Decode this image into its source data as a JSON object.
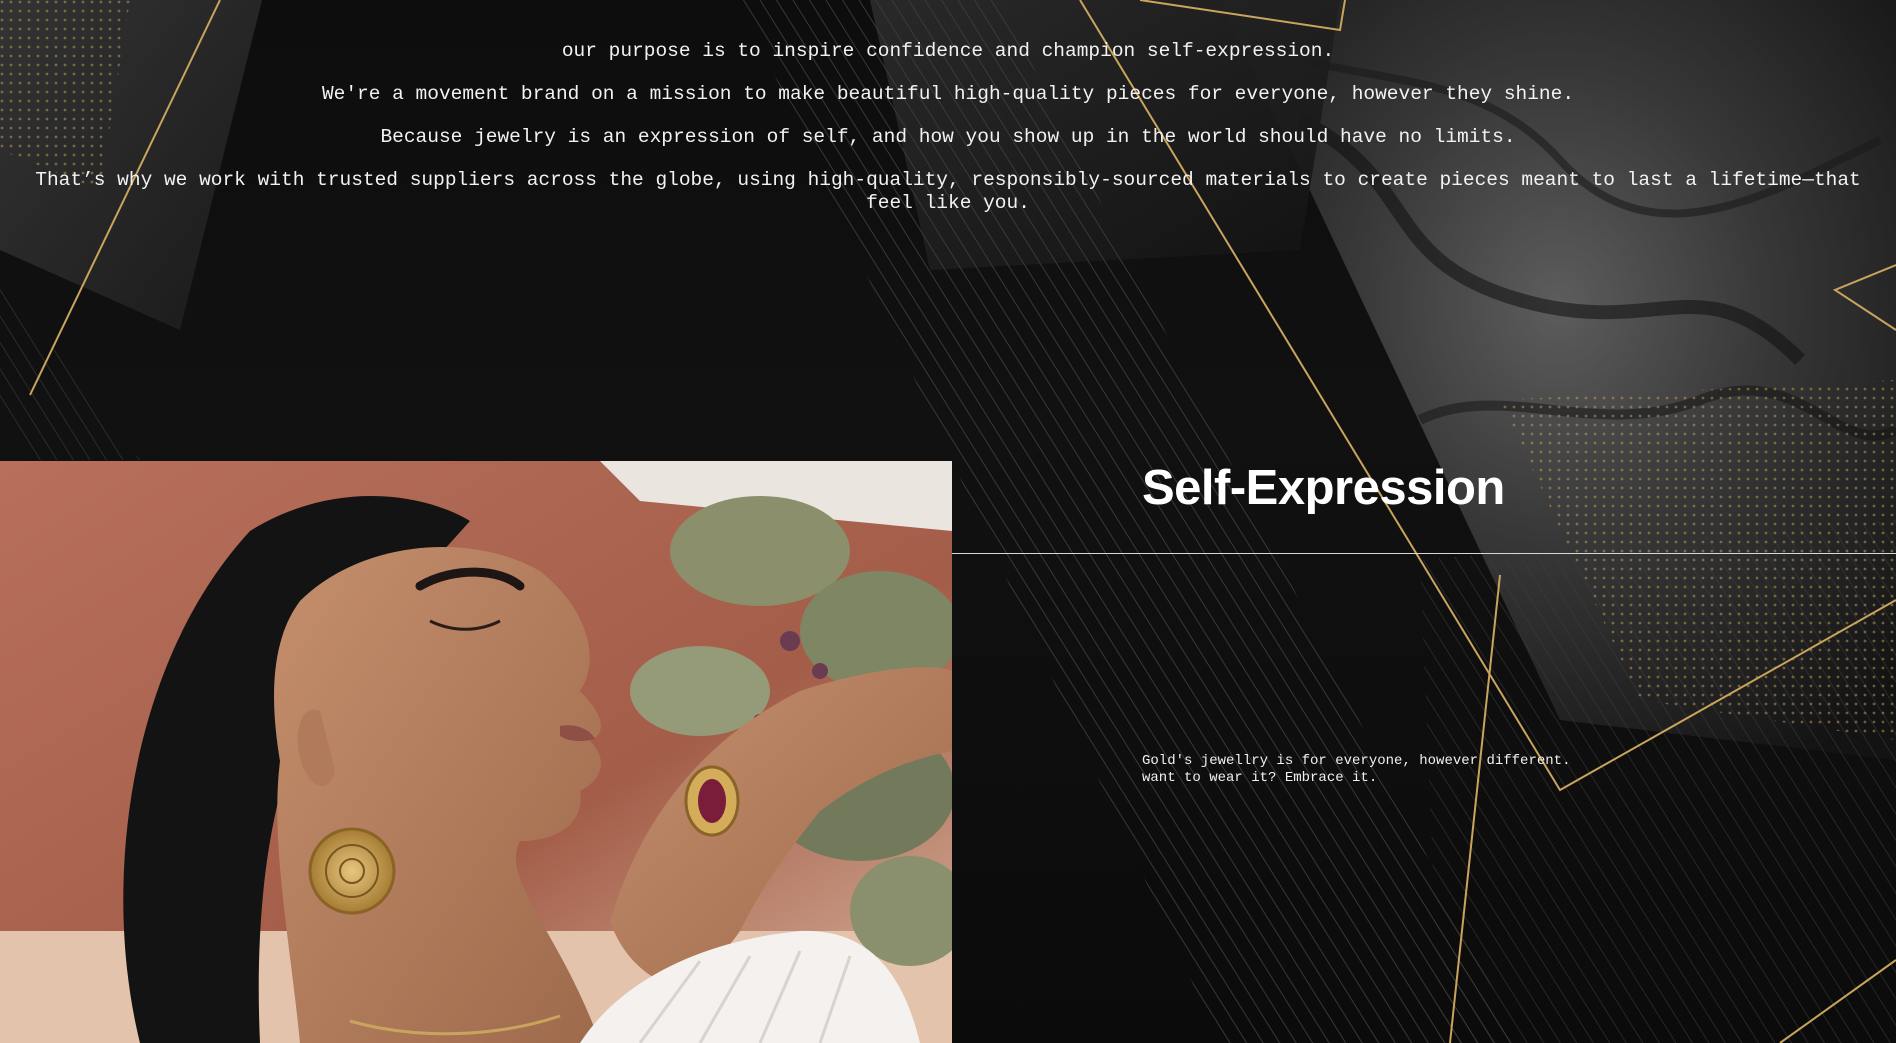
{
  "intro": {
    "lines": [
      "our purpose is to inspire confidence and champion self-expression.",
      "We're a movement brand on a mission to make beautiful high-quality pieces for everyone, however they shine.",
      "Because jewelry is an expression of self, and how you show up in the world should have no limits.",
      "That’s why we work with trusted suppliers across the globe, using high-quality, responsibly-sourced materials to create pieces meant to last a lifetime—that feel like you."
    ]
  },
  "feature": {
    "title": "Self-Expression",
    "description_lines": [
      "Gold's jewellry is for everyone, however different.",
      "want to wear it? Embrace it."
    ]
  },
  "theme": {
    "background": "#0c0c0c",
    "gold": "#c9a45c",
    "text": "#f2f2f2"
  }
}
